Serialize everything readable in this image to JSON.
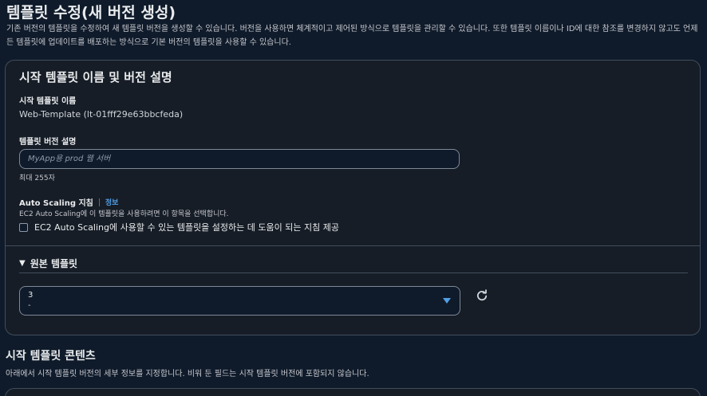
{
  "page": {
    "title": "템플릿 수정(새 버전 생성)",
    "description": "기존 버전의 템플릿을 수정하여 새 템플릿 버전을 생성할 수 있습니다. 버전을 사용하면 체계적이고 제어된 방식으로 템플릿을 관리할 수 있습니다. 또한 템플릿 이름이나 ID에 대한 참조를 변경하지 않고도 언제든 템플릿에 업데이트를 배포하는 방식으로 기본 버전의 템플릿을 사용할 수 있습니다."
  },
  "panel": {
    "title": "시작 템플릿 이름 및 버전 설명",
    "template_name_label": "시작 템플릿 이름",
    "template_name_value": "Web-Template (lt-01fff29e63bbcfeda)",
    "version_desc_label": "템플릿 버전 설명",
    "version_desc_placeholder": "MyApp용 prod 웹 서버",
    "version_desc_value": "",
    "version_desc_hint": "최대 255자",
    "auto_scaling": {
      "label": "Auto Scaling 지침",
      "info_link": "정보",
      "description": "EC2 Auto Scaling에 이 템플릿을 사용하려면 이 항목을 선택합니다.",
      "checkbox_label": "EC2 Auto Scaling에 사용할 수 있는 템플릿을 설정하는 데 도움이 되는 지침 제공",
      "checked": false
    },
    "source_template": {
      "label": "원본 템플릿",
      "expanded": true,
      "selected_value": "3",
      "selected_sub": "-"
    }
  },
  "contents_section": {
    "title": "시작 템플릿 콘텐츠",
    "description": "아래에서 시작 템플릿 버전의 세부 정보를 지정합니다. 비워 둔 필드는 시작 템플릿 버전에 포함되지 않습니다."
  },
  "colors": {
    "background": "#0f1b2a",
    "panel": "#161d26",
    "accent": "#539fe5"
  }
}
